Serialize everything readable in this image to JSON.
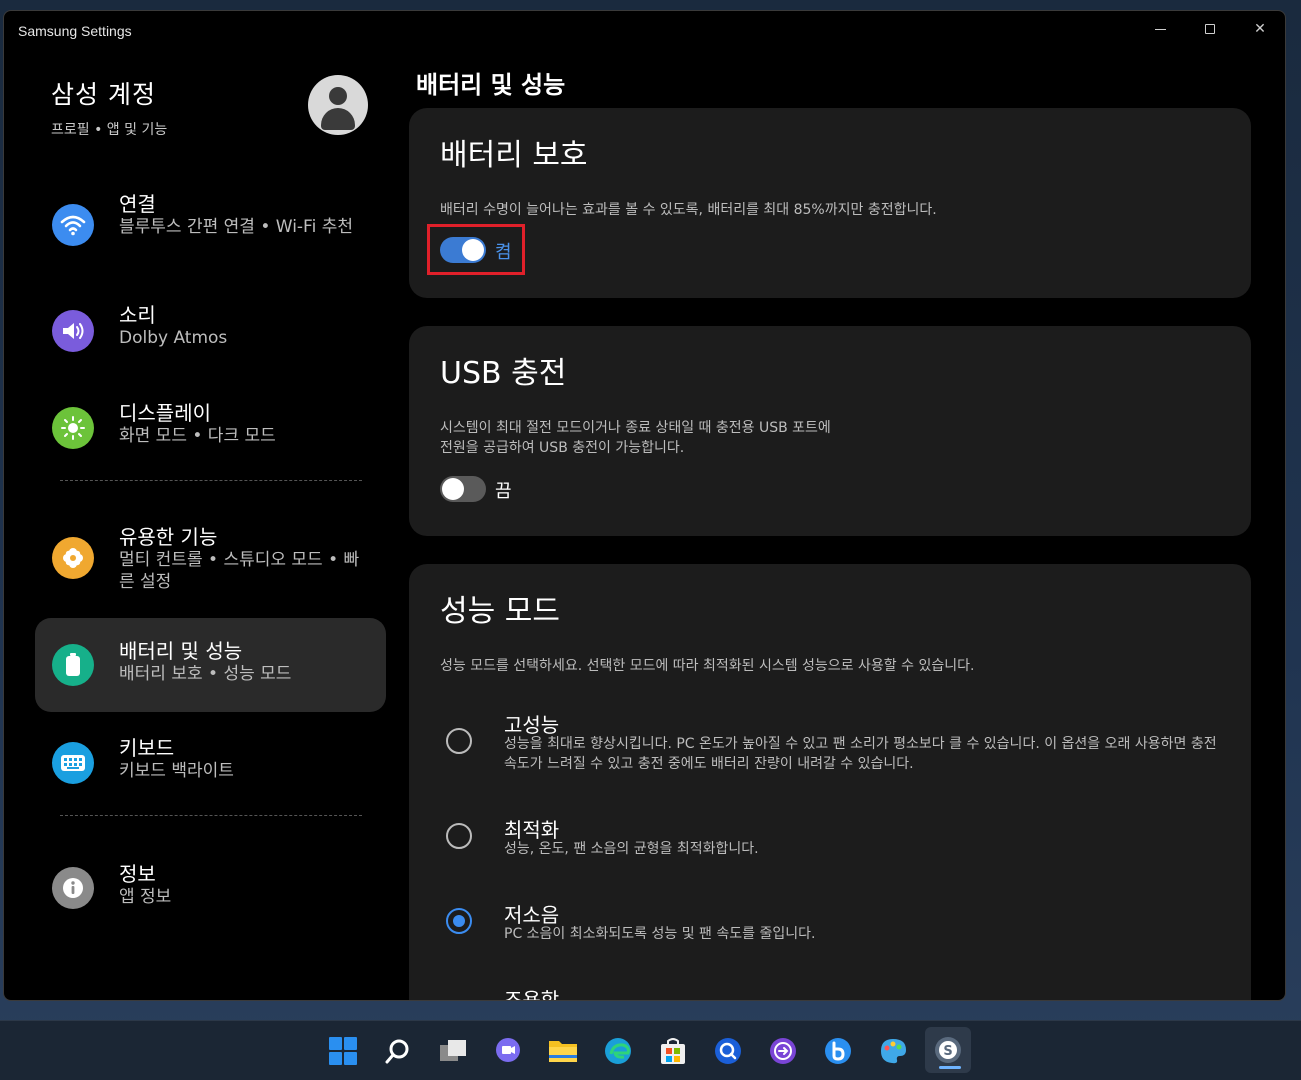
{
  "window": {
    "title": "Samsung Settings"
  },
  "account": {
    "name": "삼성 계정",
    "sub": "프로필 • 앱 및 기능"
  },
  "sidebar": {
    "items": [
      {
        "title": "연결",
        "sub": "블루투스 간편 연결  •  Wi-Fi 추천",
        "color": "#3c8cf0"
      },
      {
        "title": "소리",
        "sub": "Dolby Atmos",
        "color": "#7a5cdc"
      },
      {
        "title": "디스플레이",
        "sub": "화면 모드  •  다크 모드",
        "color": "#6cc33a"
      },
      {
        "title": "유용한 기능",
        "sub": "멀티 컨트롤  •  스튜디오 모드  •  빠른 설정",
        "color": "#f0a830"
      },
      {
        "title": "배터리 및 성능",
        "sub": "배터리 보호  •  성능 모드",
        "color": "#16b08a"
      },
      {
        "title": "키보드",
        "sub": "키보드 백라이트",
        "color": "#1a9fe0"
      },
      {
        "title": "정보",
        "sub": "앱 정보",
        "color": "#8a8a8a"
      }
    ]
  },
  "main": {
    "page_title": "배터리 및 성능",
    "battery": {
      "title": "배터리 보호",
      "desc": "배터리 수명이 늘어나는 효과를 볼 수 있도록, 배터리를 최대 85%까지만 충전합니다.",
      "toggle_label": "켬"
    },
    "usb": {
      "title": "USB 충전",
      "desc1": "시스템이 최대 절전 모드이거나 종료 상태일 때 충전용 USB 포트에",
      "desc2": "전원을 공급하여 USB 충전이 가능합니다.",
      "toggle_label": "끔"
    },
    "perf": {
      "title": "성능 모드",
      "desc": "성능 모드를 선택하세요. 선택한 모드에 따라 최적화된 시스템 성능으로 사용할 수 있습니다.",
      "options": [
        {
          "title": "고성능",
          "desc": "성능을 최대로 향상시킵니다. PC 온도가 높아질 수 있고 팬 소리가 평소보다 클 수 있습니다. 이 옵션을 오래 사용하면 충전 속도가 느려질 수 있고 충전 중에도 배터리 잔량이 내려갈 수 있습니다."
        },
        {
          "title": "최적화",
          "desc": "성능, 온도, 팬 소음의 균형을 최적화합니다."
        },
        {
          "title": "저소음",
          "desc": "PC 소음이 최소화되도록 성능 및 팬 속도를 줄입니다."
        },
        {
          "title": "조용함",
          "desc": ""
        }
      ]
    }
  },
  "colors": {
    "accent": "#3b7bd3",
    "highlight": "#e0202a"
  },
  "taskbar": {
    "icons": [
      "start-icon",
      "search-icon",
      "task-view-icon",
      "chat-icon",
      "file-explorer-icon",
      "edge-icon",
      "store-icon",
      "quick-search-icon",
      "quick-share-icon",
      "bixby-icon",
      "paint-icon",
      "samsung-settings-icon"
    ]
  }
}
